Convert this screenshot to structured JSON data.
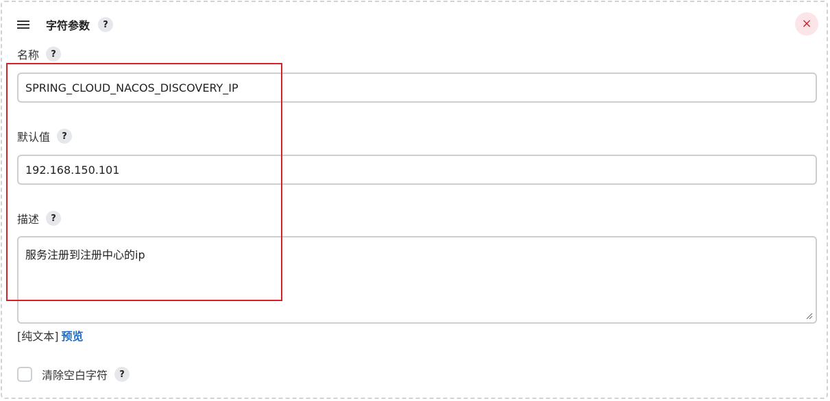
{
  "section": {
    "title": "字符参数",
    "help_glyph": "?",
    "close_glyph": "×"
  },
  "name_field": {
    "label": "名称",
    "value": "SPRING_CLOUD_NACOS_DISCOVERY_IP"
  },
  "default_field": {
    "label": "默认值",
    "value": "192.168.150.101"
  },
  "description_field": {
    "label": "描述",
    "value": "服务注册到注册中心的ip"
  },
  "format": {
    "plain_text": "[纯文本]",
    "preview": "预览"
  },
  "trim_option": {
    "label": "清除空白字符",
    "checked": false
  },
  "colors": {
    "highlight": "#d32029",
    "link": "#1f6cc5",
    "close": "#d0262e"
  }
}
